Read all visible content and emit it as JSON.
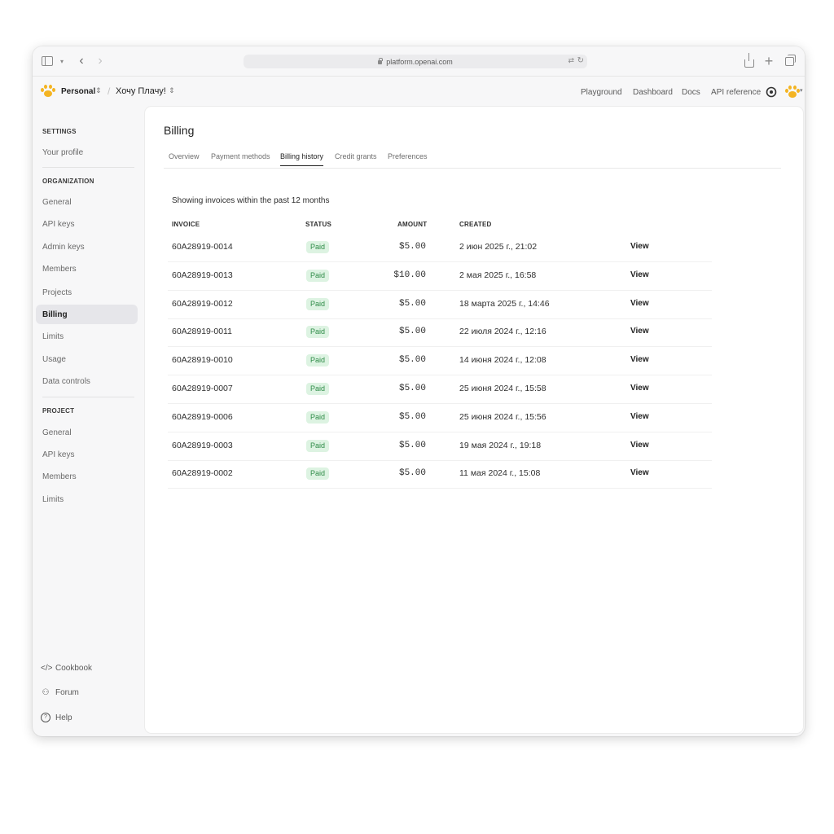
{
  "browser": {
    "url": "platform.openai.com"
  },
  "header": {
    "org_name": "Personal",
    "project_name": "Хочу Плачу!",
    "nav": [
      "Playground",
      "Dashboard",
      "Docs",
      "API reference"
    ]
  },
  "sidebar": {
    "settings_title": "SETTINGS",
    "settings_items": [
      "Your profile"
    ],
    "organization_title": "ORGANIZATION",
    "organization_items": [
      "General",
      "API keys",
      "Admin keys",
      "Members",
      "Projects",
      "Billing",
      "Limits",
      "Usage",
      "Data controls"
    ],
    "active_item": "Billing",
    "project_title": "PROJECT",
    "project_items": [
      "General",
      "API keys",
      "Members",
      "Limits"
    ],
    "footer": [
      {
        "label": "Cookbook",
        "icon": "code-icon"
      },
      {
        "label": "Forum",
        "icon": "people-icon"
      },
      {
        "label": "Help",
        "icon": "help-icon"
      }
    ]
  },
  "main": {
    "title": "Billing",
    "tabs": [
      "Overview",
      "Payment methods",
      "Billing history",
      "Credit grants",
      "Preferences"
    ],
    "active_tab": "Billing history",
    "caption": "Showing invoices within the past 12 months",
    "columns": [
      "INVOICE",
      "STATUS",
      "AMOUNT",
      "CREATED"
    ],
    "invoices": [
      {
        "id": "60A28919-0014",
        "status": "Paid",
        "amount": "$5.00",
        "created": "2 июн 2025 г., 21:02",
        "action": "View"
      },
      {
        "id": "60A28919-0013",
        "status": "Paid",
        "amount": "$10.00",
        "created": "2 мая 2025 г., 16:58",
        "action": "View"
      },
      {
        "id": "60A28919-0012",
        "status": "Paid",
        "amount": "$5.00",
        "created": "18 марта 2025 г., 14:46",
        "action": "View"
      },
      {
        "id": "60A28919-0011",
        "status": "Paid",
        "amount": "$5.00",
        "created": "22 июля 2024 г., 12:16",
        "action": "View"
      },
      {
        "id": "60A28919-0010",
        "status": "Paid",
        "amount": "$5.00",
        "created": "14 июня 2024 г., 12:08",
        "action": "View"
      },
      {
        "id": "60A28919-0007",
        "status": "Paid",
        "amount": "$5.00",
        "created": "25 июня 2024 г., 15:58",
        "action": "View"
      },
      {
        "id": "60A28919-0006",
        "status": "Paid",
        "amount": "$5.00",
        "created": "25 июня 2024 г., 15:56",
        "action": "View"
      },
      {
        "id": "60A28919-0003",
        "status": "Paid",
        "amount": "$5.00",
        "created": "19 мая 2024 г., 19:18",
        "action": "View"
      },
      {
        "id": "60A28919-0002",
        "status": "Paid",
        "amount": "$5.00",
        "created": "11 мая 2024 г., 15:08",
        "action": "View"
      }
    ]
  },
  "colors": {
    "accent_paw": "#f4b422",
    "paid_badge_bg": "#ddf3e2",
    "paid_badge_text": "#2e8b47",
    "active_sidebar_bg": "#e6e6ea"
  }
}
